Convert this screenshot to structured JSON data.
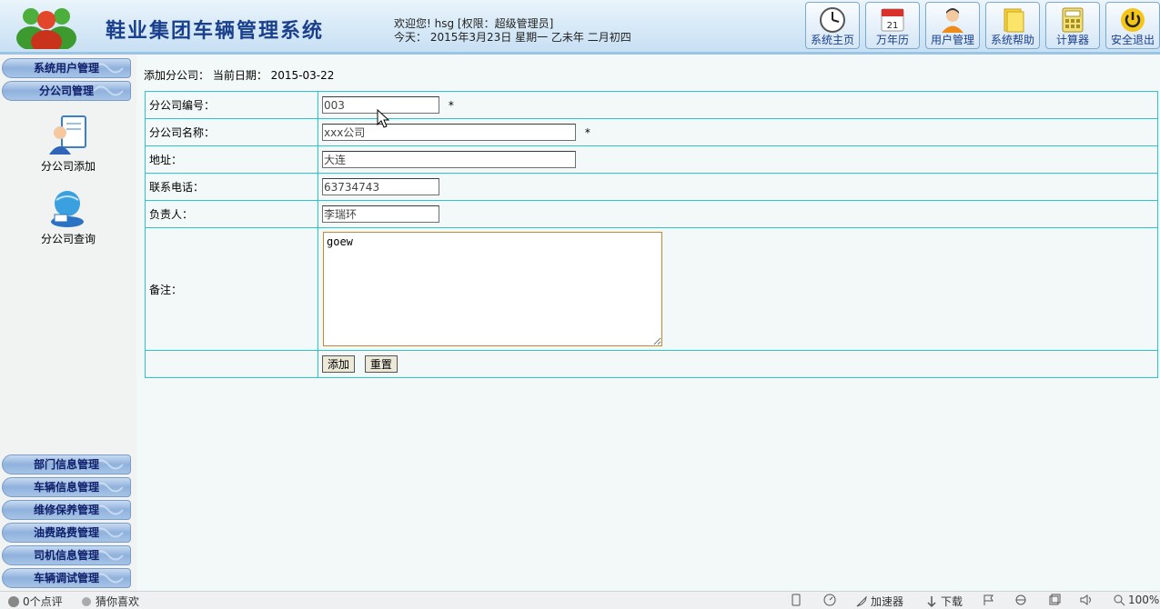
{
  "header": {
    "title": "鞋业集团车辆管理系统",
    "welcome_line": "欢迎您! hsg [权限：超级管理员]",
    "date_line": "今天： 2015年3月23日 星期一 乙未年 二月初四",
    "toolbar": [
      {
        "label": "系统主页",
        "icon": "clock-icon"
      },
      {
        "label": "万年历",
        "icon": "calendar-icon"
      },
      {
        "label": "用户管理",
        "icon": "user-icon"
      },
      {
        "label": "系统帮助",
        "icon": "help-notes-icon"
      },
      {
        "label": "计算器",
        "icon": "calculator-icon"
      },
      {
        "label": "安全退出",
        "icon": "power-icon"
      }
    ]
  },
  "sidebar": {
    "top_menu": [
      "系统用户管理",
      "分公司管理"
    ],
    "sub_items": [
      {
        "label": "分公司添加",
        "icon": "add-company-icon"
      },
      {
        "label": "分公司查询",
        "icon": "search-company-icon"
      }
    ],
    "bottom_menu": [
      "部门信息管理",
      "车辆信息管理",
      "维修保养管理",
      "油费路费管理",
      "司机信息管理",
      "车辆调试管理"
    ]
  },
  "main": {
    "crumb": "添加分公司： 当前日期： 2015-03-22",
    "form": {
      "code_label": "分公司编号：",
      "code_value": "003",
      "name_label": "分公司名称：",
      "name_value": "xxx公司",
      "address_label": "地址：",
      "address_value": "大连",
      "phone_label": "联系电话：",
      "phone_value": "63734743",
      "manager_label": "负责人：",
      "manager_value": "李瑞环",
      "remark_label": "备注：",
      "remark_value": "goew",
      "required_mark": "*",
      "add_button": "添加",
      "reset_button": "重置"
    }
  },
  "statusbar": {
    "left": [
      "0个点评",
      "猜你喜欢"
    ],
    "accelerator": "加速器",
    "download": "下载",
    "zoom": "100%"
  }
}
